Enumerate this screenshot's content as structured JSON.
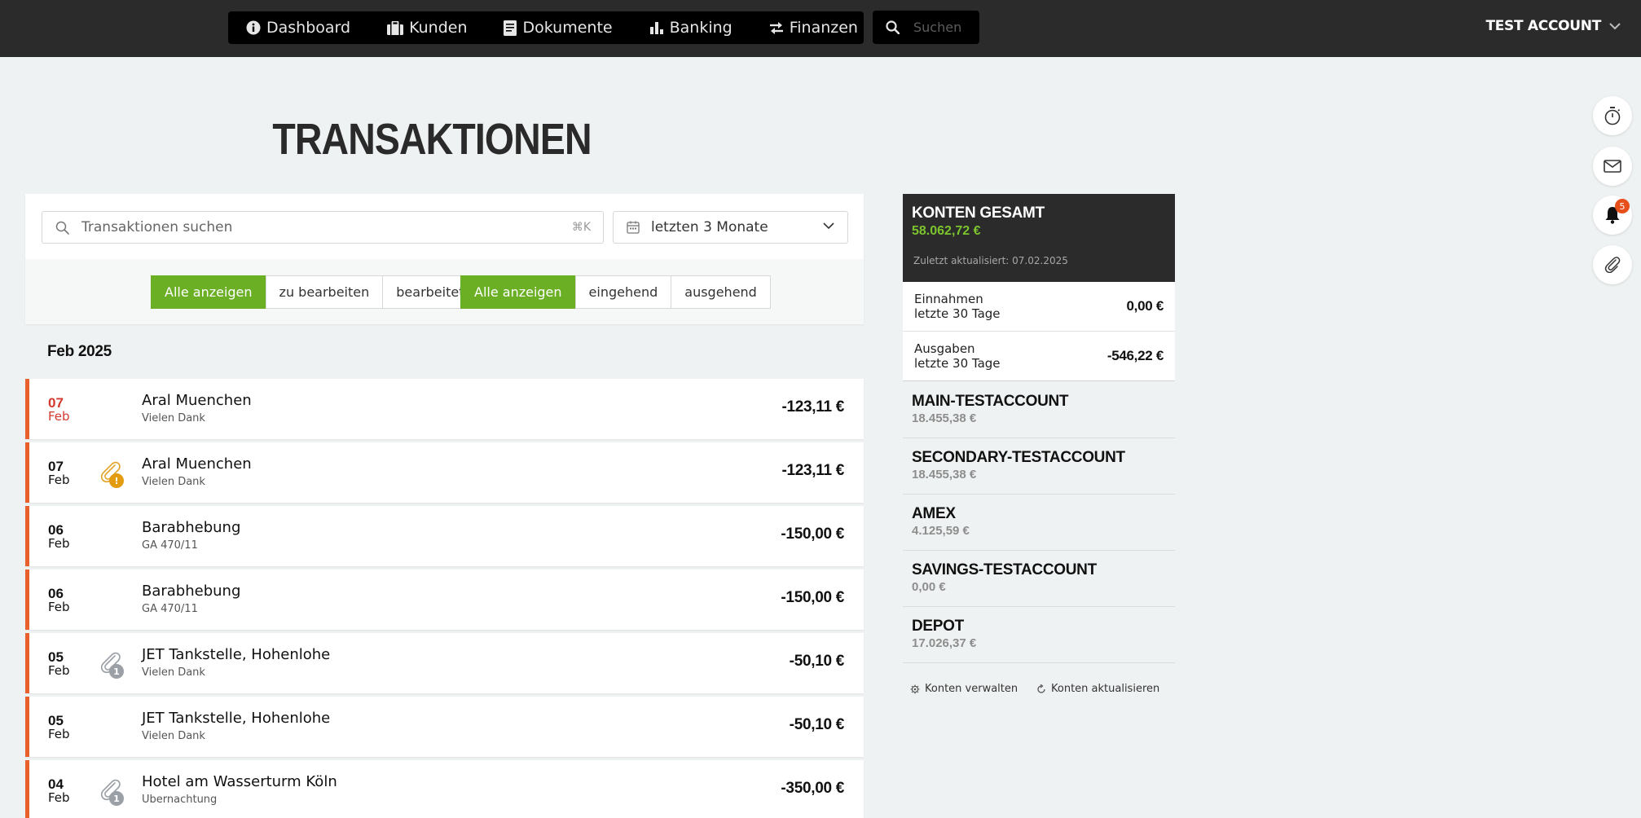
{
  "nav": {
    "items": [
      {
        "label": "Dashboard",
        "icon": "info-circle-icon"
      },
      {
        "label": "Kunden",
        "icon": "briefcase-icon"
      },
      {
        "label": "Dokumente",
        "icon": "document-icon"
      },
      {
        "label": "Banking",
        "icon": "bar-chart-icon"
      },
      {
        "label": "Finanzen",
        "icon": "exchange-arrows-icon"
      }
    ],
    "search_placeholder": "Suchen",
    "account_label": "TEST ACCOUNT"
  },
  "side_actions": {
    "notification_count": "5",
    "icons": [
      "stopwatch-icon",
      "mail-icon",
      "bell-icon",
      "paperclip-icon"
    ]
  },
  "page": {
    "title": "TRANSAKTIONEN"
  },
  "filters": {
    "search_placeholder": "Transaktionen suchen",
    "search_shortcut": "⌘K",
    "period": "letzten 3 Monate",
    "status_group": [
      "Alle anzeigen",
      "zu bearbeiten",
      "bearbeitet"
    ],
    "direction_group": [
      "Alle anzeigen",
      "eingehend",
      "ausgehend"
    ],
    "status_active": 0,
    "direction_active": 0
  },
  "month_heading": "Feb 2025",
  "transactions": [
    {
      "day": "07",
      "month": "Feb",
      "title": "Aral Muenchen",
      "subtitle": "Vielen Dank",
      "amount": "-123,11 €",
      "attachment": "none",
      "highlight": true
    },
    {
      "day": "07",
      "month": "Feb",
      "title": "Aral Muenchen",
      "subtitle": "Vielen Dank",
      "amount": "-123,11 €",
      "attachment": "warning",
      "badge": "!"
    },
    {
      "day": "06",
      "month": "Feb",
      "title": "Barabhebung",
      "subtitle": "GA 470/11",
      "amount": "-150,00 €",
      "attachment": "none"
    },
    {
      "day": "06",
      "month": "Feb",
      "title": "Barabhebung",
      "subtitle": "GA 470/11",
      "amount": "-150,00 €",
      "attachment": "none"
    },
    {
      "day": "05",
      "month": "Feb",
      "title": "JET Tankstelle, Hohenlohe",
      "subtitle": "Vielen Dank",
      "amount": "-50,10 €",
      "attachment": "count",
      "badge": "1"
    },
    {
      "day": "05",
      "month": "Feb",
      "title": "JET Tankstelle, Hohenlohe",
      "subtitle": "Vielen Dank",
      "amount": "-50,10 €",
      "attachment": "none"
    },
    {
      "day": "04",
      "month": "Feb",
      "title": "Hotel am Wasserturm Köln",
      "subtitle": "Ubernachtung",
      "amount": "-350,00 €",
      "attachment": "count",
      "badge": "1"
    }
  ],
  "accounts": {
    "total_label": "KONTEN GESAMT",
    "total_value": "58.062,72 €",
    "updated": "Zuletzt aktualisiert: 07.02.2025",
    "income": {
      "line1": "Einnahmen",
      "line2": "letzte 30 Tage",
      "value": "0,00 €"
    },
    "expenses": {
      "line1": "Ausgaben",
      "line2": "letzte 30 Tage",
      "value": "-546,22 €"
    },
    "list": [
      {
        "name": "MAIN-TESTACCOUNT",
        "balance": "18.455,38 €"
      },
      {
        "name": "SECONDARY-TESTACCOUNT",
        "balance": "18.455,38 €"
      },
      {
        "name": "AMEX",
        "balance": "4.125,59 €"
      },
      {
        "name": "SAVINGS-TESTACCOUNT",
        "balance": "0,00 €"
      },
      {
        "name": "DEPOT",
        "balance": "17.026,37 €"
      }
    ],
    "manage_label": "Konten verwalten",
    "refresh_label": "Konten aktualisieren"
  },
  "colors": {
    "accent_green": "#6aaf24",
    "total_green": "#7cc42e",
    "row_marker": "#e8602b",
    "date_highlight": "#d23a2e",
    "badge_orange": "#e8501b",
    "warning_badge": "#e39b12",
    "count_badge": "#9aa0a6"
  }
}
